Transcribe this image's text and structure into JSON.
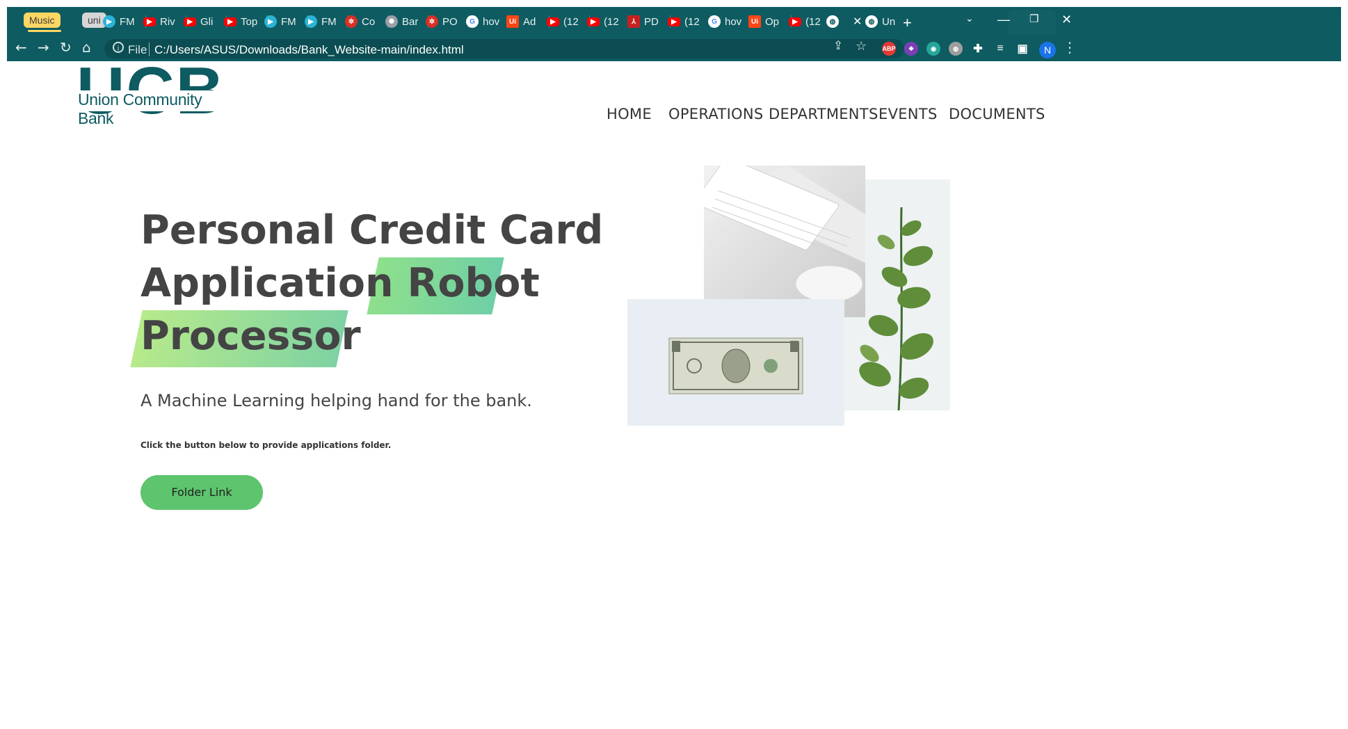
{
  "browser": {
    "tab_groups": [
      "Music",
      "uni"
    ],
    "tabs": [
      {
        "title": "FM",
        "icon": "play-icon"
      },
      {
        "title": "Riv",
        "icon": "youtube-icon"
      },
      {
        "title": "Gli",
        "icon": "youtube-icon"
      },
      {
        "title": "Top",
        "icon": "youtube-icon"
      },
      {
        "title": "FM",
        "icon": "play-icon"
      },
      {
        "title": "FM",
        "icon": "play-icon"
      },
      {
        "title": "Co",
        "icon": "gear-icon"
      },
      {
        "title": "Bar",
        "icon": "openai-icon"
      },
      {
        "title": "PO",
        "icon": "gear-icon"
      },
      {
        "title": "hov",
        "icon": "google-icon"
      },
      {
        "title": "Ad",
        "icon": "uipath-icon"
      },
      {
        "title": "(12",
        "icon": "youtube-icon"
      },
      {
        "title": "(12",
        "icon": "youtube-icon"
      },
      {
        "title": "PD",
        "icon": "pdf-icon"
      },
      {
        "title": "(12",
        "icon": "youtube-icon"
      },
      {
        "title": "hov",
        "icon": "google-icon"
      },
      {
        "title": "Op",
        "icon": "uipath-icon"
      },
      {
        "title": "(12",
        "icon": "youtube-icon"
      },
      {
        "title": "",
        "icon": "globe-icon",
        "active": true
      },
      {
        "title": "Un",
        "icon": "globe-icon"
      }
    ],
    "address": {
      "scheme_label": "File",
      "url": "C:/Users/ASUS/Downloads/Bank_Website-main/index.html"
    },
    "extensions": [
      "ABP"
    ],
    "profile_initial": "N",
    "accent": "#0e5b61"
  },
  "site": {
    "logo": {
      "letters": "UCB",
      "name": "Union Community Bank"
    },
    "nav": [
      "HOME",
      "OPERATIONS",
      "DEPARTMENTS",
      "EVENTS",
      "DOCUMENTS"
    ],
    "hero": {
      "line1": "Personal Credit Card",
      "line2a": "Application",
      "line2b": "Robot",
      "line3": "Processor",
      "subtitle": "A Machine Learning helping hand for the bank.",
      "instruction": "Click the button below to provide applications folder.",
      "button": "Folder Link"
    },
    "colors": {
      "brand": "#0e5b61",
      "button": "#5ec46d",
      "highlight": "#8ee08b"
    }
  }
}
